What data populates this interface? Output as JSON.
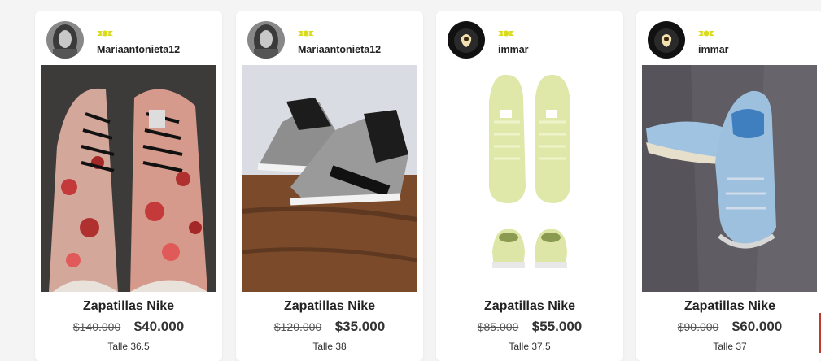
{
  "listings": [
    {
      "username": "Mariaantonieta12",
      "badge_icon": "yellow-badge-icon",
      "title": "Zapatillas Nike",
      "original_price": "$140.000",
      "price": "$40.000",
      "size": "Talle 36.5"
    },
    {
      "username": "Mariaantonieta12",
      "badge_icon": "yellow-badge-icon",
      "title": "Zapatillas Nike",
      "original_price": "$120.000",
      "price": "$35.000",
      "size": "Talle 38"
    },
    {
      "username": "immar",
      "badge_icon": "yellow-badge-icon",
      "title": "Zapatillas Nike",
      "original_price": "$85.000",
      "price": "$55.000",
      "size": "Talle 37.5"
    },
    {
      "username": "immar",
      "badge_icon": "yellow-badge-icon",
      "title": "Zapatillas Nike",
      "original_price": "$90.000",
      "price": "$60.000",
      "size": "Talle 37"
    }
  ],
  "colors": {
    "badge": "#d9dc1c",
    "card_bg": "#ffffff",
    "page_bg": "#f4f4f4"
  }
}
